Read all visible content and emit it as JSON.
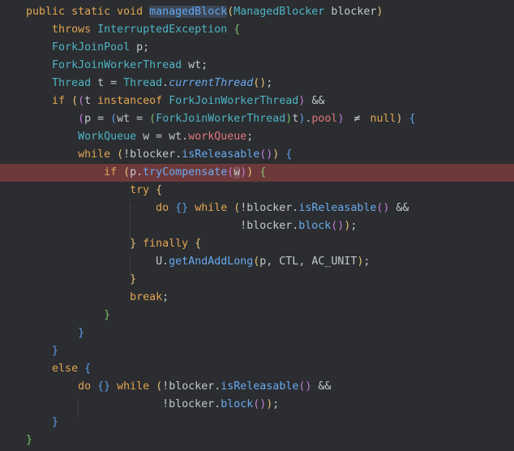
{
  "editor": {
    "colors": {
      "background": "#2b2d30",
      "text": "#c4c7ce",
      "current_line": "#6e393b",
      "indent_guide": "#3e4046"
    },
    "lines": [
      {
        "tokens": [
          {
            "t": "    "
          },
          {
            "t": "public static void ",
            "c": "#e2a552"
          },
          {
            "t": "managedBlock",
            "c": "#5fa8f3",
            "hl": true
          },
          {
            "t": "(",
            "c": "#e5c07b"
          },
          {
            "t": "ManagedBlocker",
            "c": "#4fb4c6"
          },
          {
            "t": " blocker",
            "c": "#c4c7ce"
          },
          {
            "t": ")",
            "c": "#e5c07b"
          }
        ]
      },
      {
        "tokens": [
          {
            "t": "        "
          },
          {
            "t": "throws ",
            "c": "#e2a552"
          },
          {
            "t": "InterruptedException",
            "c": "#4fb4c6"
          },
          {
            "t": " "
          },
          {
            "t": "{",
            "c": "#7dbf6a"
          }
        ]
      },
      {
        "tokens": [
          {
            "t": "        "
          },
          {
            "t": "ForkJoinPool",
            "c": "#4fb4c6"
          },
          {
            "t": " p;",
            "c": "#c4c7ce"
          }
        ]
      },
      {
        "tokens": [
          {
            "t": "        "
          },
          {
            "t": "ForkJoinWorkerThread",
            "c": "#4fb4c6"
          },
          {
            "t": " wt;",
            "c": "#c4c7ce"
          }
        ]
      },
      {
        "tokens": [
          {
            "t": "        "
          },
          {
            "t": "Thread",
            "c": "#4fb4c6"
          },
          {
            "t": " t = ",
            "c": "#c4c7ce"
          },
          {
            "t": "Thread",
            "c": "#4fb4c6"
          },
          {
            "t": ".",
            "c": "#c4c7ce"
          },
          {
            "t": "currentThread",
            "c": "#6aaaf0",
            "i": true
          },
          {
            "t": "()",
            "c": "#e5c07b"
          },
          {
            "t": ";",
            "c": "#c4c7ce"
          }
        ]
      },
      {
        "tokens": [
          {
            "t": "        "
          },
          {
            "t": "if ",
            "c": "#e2a552"
          },
          {
            "t": "(",
            "c": "#e5c07b"
          },
          {
            "t": "(",
            "c": "#c27fd8"
          },
          {
            "t": "t ",
            "c": "#c4c7ce"
          },
          {
            "t": "instanceof ",
            "c": "#e2a552"
          },
          {
            "t": "ForkJoinWorkerThread",
            "c": "#4fb4c6"
          },
          {
            "t": ")",
            "c": "#c27fd8"
          },
          {
            "t": " &&",
            "c": "#c4c7ce"
          }
        ]
      },
      {
        "tokens": [
          {
            "t": "            "
          },
          {
            "t": "(",
            "c": "#c27fd8"
          },
          {
            "t": "p = ",
            "c": "#c4c7ce"
          },
          {
            "t": "(",
            "c": "#5f9cf0"
          },
          {
            "t": "wt = ",
            "c": "#c4c7ce"
          },
          {
            "t": "(",
            "c": "#7dbf6a"
          },
          {
            "t": "ForkJoinWorkerThread",
            "c": "#4fb4c6"
          },
          {
            "t": ")",
            "c": "#7dbf6a"
          },
          {
            "t": "t",
            "c": "#c4c7ce"
          },
          {
            "t": ")",
            "c": "#5f9cf0"
          },
          {
            "t": ".",
            "c": "#c4c7ce"
          },
          {
            "t": "pool",
            "c": "#e2787c"
          },
          {
            "t": ")",
            "c": "#c27fd8"
          },
          {
            "t": " "
          },
          {
            "t": "≠",
            "c": "#c4c7ce"
          },
          {
            "t": " "
          },
          {
            "t": "null",
            "c": "#e2a552"
          },
          {
            "t": ")",
            "c": "#e5c07b"
          },
          {
            "t": " "
          },
          {
            "t": "{",
            "c": "#5f9cf0"
          }
        ]
      },
      {
        "tokens": [
          {
            "t": "            "
          },
          {
            "t": "WorkQueue",
            "c": "#4fb4c6"
          },
          {
            "t": " w = wt.",
            "c": "#c4c7ce"
          },
          {
            "t": "workQueue",
            "c": "#e2787c"
          },
          {
            "t": ";",
            "c": "#c4c7ce"
          }
        ]
      },
      {
        "tokens": [
          {
            "t": "            "
          },
          {
            "t": "while ",
            "c": "#e2a552"
          },
          {
            "t": "(",
            "c": "#e5c07b"
          },
          {
            "t": "!blocker.",
            "c": "#c4c7ce"
          },
          {
            "t": "isReleasable",
            "c": "#6aaaf0"
          },
          {
            "t": "()",
            "c": "#c27fd8"
          },
          {
            "t": ")",
            "c": "#e5c07b"
          },
          {
            "t": " "
          },
          {
            "t": "{",
            "c": "#5f9cf0"
          }
        ]
      },
      {
        "highlighted": true,
        "tokens": [
          {
            "t": "                "
          },
          {
            "t": "if ",
            "c": "#e2a552"
          },
          {
            "t": "(",
            "c": "#e5c07b"
          },
          {
            "t": "p.",
            "c": "#c4c7ce"
          },
          {
            "t": "tryCompensate",
            "c": "#6aaaf0"
          },
          {
            "t": "(",
            "c": "#c27fd8"
          },
          {
            "t": "w",
            "c": "#c4c7ce",
            "hl": true
          },
          {
            "t": ")",
            "c": "#c27fd8"
          },
          {
            "t": ")",
            "c": "#e5c07b"
          },
          {
            "t": " "
          },
          {
            "t": "{",
            "c": "#7dbf6a"
          }
        ]
      },
      {
        "tokens": [
          {
            "t": "                    "
          },
          {
            "t": "try ",
            "c": "#e2a552"
          },
          {
            "t": "{",
            "c": "#e5c07b"
          }
        ]
      },
      {
        "tokens": [
          {
            "t": "                        "
          },
          {
            "t": "do ",
            "c": "#e2a552"
          },
          {
            "t": "{}",
            "c": "#5f9cf0"
          },
          {
            "t": " "
          },
          {
            "t": "while ",
            "c": "#e2a552"
          },
          {
            "t": "(",
            "c": "#e5c07b"
          },
          {
            "t": "!blocker.",
            "c": "#c4c7ce"
          },
          {
            "t": "isReleasable",
            "c": "#6aaaf0"
          },
          {
            "t": "()",
            "c": "#c27fd8"
          },
          {
            "t": " &&",
            "c": "#c4c7ce"
          }
        ]
      },
      {
        "tokens": [
          {
            "t": "                                     "
          },
          {
            "t": "!blocker.",
            "c": "#c4c7ce"
          },
          {
            "t": "block",
            "c": "#6aaaf0"
          },
          {
            "t": "()",
            "c": "#c27fd8"
          },
          {
            "t": ")",
            "c": "#e5c07b"
          },
          {
            "t": ";",
            "c": "#c4c7ce"
          }
        ]
      },
      {
        "tokens": [
          {
            "t": "                    "
          },
          {
            "t": "}",
            "c": "#e5c07b"
          },
          {
            "t": " "
          },
          {
            "t": "finally ",
            "c": "#e2a552"
          },
          {
            "t": "{",
            "c": "#e5c07b"
          }
        ]
      },
      {
        "tokens": [
          {
            "t": "                        "
          },
          {
            "t": "U",
            "c": "#c4c7ce"
          },
          {
            "t": ".",
            "c": "#c4c7ce"
          },
          {
            "t": "getAndAddLong",
            "c": "#6aaaf0"
          },
          {
            "t": "(",
            "c": "#e5c07b"
          },
          {
            "t": "p, ",
            "c": "#c4c7ce"
          },
          {
            "t": "CTL",
            "c": "#c4c7ce"
          },
          {
            "t": ", ",
            "c": "#c4c7ce"
          },
          {
            "t": "AC_UNIT",
            "c": "#c4c7ce"
          },
          {
            "t": ")",
            "c": "#e5c07b"
          },
          {
            "t": ";",
            "c": "#c4c7ce"
          }
        ]
      },
      {
        "tokens": [
          {
            "t": "                    "
          },
          {
            "t": "}",
            "c": "#e5c07b"
          }
        ]
      },
      {
        "tokens": [
          {
            "t": "                    "
          },
          {
            "t": "break",
            "c": "#e2a552"
          },
          {
            "t": ";",
            "c": "#c4c7ce"
          }
        ]
      },
      {
        "tokens": [
          {
            "t": "                "
          },
          {
            "t": "}",
            "c": "#7dbf6a"
          }
        ]
      },
      {
        "tokens": [
          {
            "t": "            "
          },
          {
            "t": "}",
            "c": "#5f9cf0"
          }
        ]
      },
      {
        "tokens": [
          {
            "t": "        "
          },
          {
            "t": "}",
            "c": "#5f9cf0"
          }
        ]
      },
      {
        "tokens": [
          {
            "t": "        "
          },
          {
            "t": "else ",
            "c": "#e2a552"
          },
          {
            "t": "{",
            "c": "#5f9cf0"
          }
        ]
      },
      {
        "tokens": [
          {
            "t": "            "
          },
          {
            "t": "do ",
            "c": "#e2a552"
          },
          {
            "t": "{}",
            "c": "#5f9cf0"
          },
          {
            "t": " "
          },
          {
            "t": "while ",
            "c": "#e2a552"
          },
          {
            "t": "(",
            "c": "#e5c07b"
          },
          {
            "t": "!blocker.",
            "c": "#c4c7ce"
          },
          {
            "t": "isReleasable",
            "c": "#6aaaf0"
          },
          {
            "t": "()",
            "c": "#c27fd8"
          },
          {
            "t": " &&",
            "c": "#c4c7ce"
          }
        ]
      },
      {
        "tokens": [
          {
            "t": "                         "
          },
          {
            "t": "!blocker.",
            "c": "#c4c7ce"
          },
          {
            "t": "block",
            "c": "#6aaaf0"
          },
          {
            "t": "()",
            "c": "#c27fd8"
          },
          {
            "t": ")",
            "c": "#e5c07b"
          },
          {
            "t": ";",
            "c": "#c4c7ce"
          }
        ]
      },
      {
        "tokens": [
          {
            "t": "        "
          },
          {
            "t": "}",
            "c": "#5f9cf0"
          }
        ]
      },
      {
        "tokens": [
          {
            "t": "    "
          },
          {
            "t": "}",
            "c": "#7dbf6a"
          }
        ]
      }
    ]
  }
}
